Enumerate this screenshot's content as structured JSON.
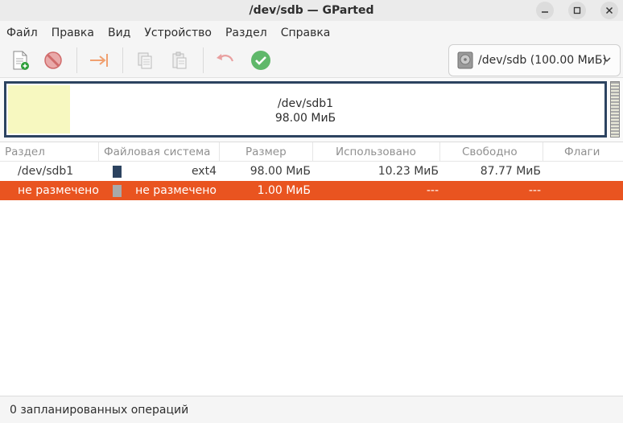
{
  "window": {
    "title": "/dev/sdb — GParted",
    "buttons": [
      "minimize",
      "maximize",
      "close"
    ]
  },
  "menu": {
    "items": [
      "Файл",
      "Правка",
      "Вид",
      "Устройство",
      "Раздел",
      "Справка"
    ]
  },
  "toolbar": {
    "icons": [
      "new-partition-icon",
      "delete-icon",
      "resize-move-icon",
      "copy-icon",
      "paste-icon",
      "undo-icon",
      "apply-icon"
    ],
    "device_selector": {
      "label": "/dev/sdb (100.00 МиБ)",
      "icon": "harddisk-icon"
    }
  },
  "diskmap": {
    "partition_name": "/dev/sdb1",
    "partition_size": "98.00 МиБ",
    "used_fraction": 0.104
  },
  "table": {
    "columns": [
      "Раздел",
      "Файловая система",
      "Размер",
      "Использовано",
      "Свободно",
      "Флаги"
    ],
    "rows": [
      {
        "partition": "/dev/sdb1",
        "filesystem": "ext4",
        "size": "98.00 МиБ",
        "used": "10.23 МиБ",
        "free": "87.77 МиБ",
        "flags": "",
        "color": "#2c4360",
        "selected": false
      },
      {
        "partition": "не размечено",
        "filesystem": "не размечено",
        "size": "1.00 МиБ",
        "used": "---",
        "free": "---",
        "flags": "",
        "color": "#a9a9a9",
        "selected": true
      }
    ]
  },
  "status": {
    "text": "0 запланированных операций"
  },
  "colors": {
    "accent": "#e95420",
    "ext4": "#2c4360",
    "unallocated": "#a9a9a9",
    "used_space": "#f7f8c0"
  }
}
